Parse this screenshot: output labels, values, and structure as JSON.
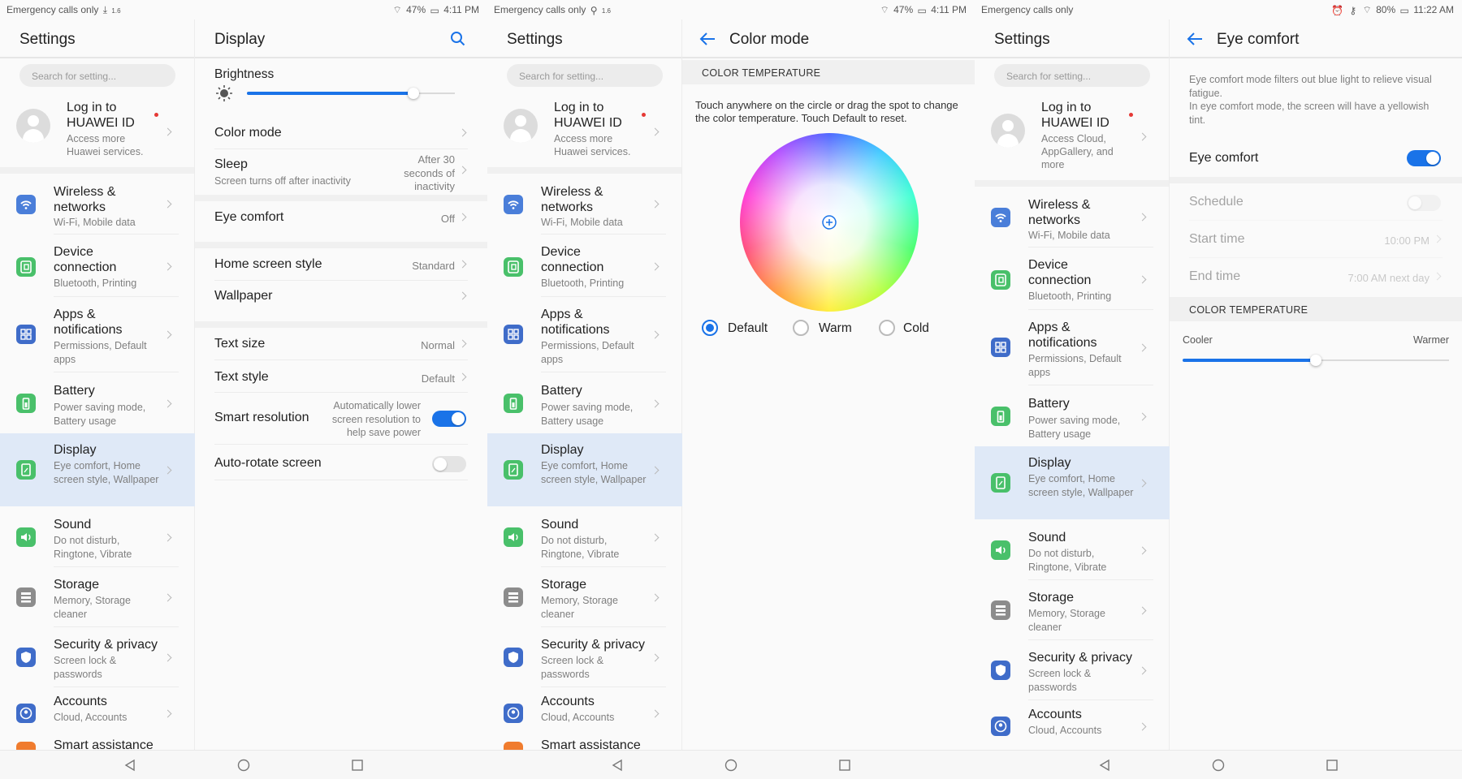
{
  "settings_list": {
    "title": "Settings",
    "search_placeholder": "Search for setting...",
    "account": {
      "name": "Log in to HUAWEI ID",
      "sub_a": "Access more Huawei services.",
      "sub_c": "Access Cloud, AppGallery, and more"
    },
    "items": [
      {
        "title": "Wireless & networks",
        "sub": "Wi-Fi, Mobile data",
        "icon": "wifi-icon"
      },
      {
        "title": "Device connection",
        "sub": "Bluetooth, Printing",
        "icon": "device-connection-icon"
      },
      {
        "title": "Apps & notifications",
        "sub": "Permissions, Default apps",
        "icon": "apps-icon"
      },
      {
        "title": "Battery",
        "sub": "Power saving mode, Battery usage",
        "icon": "battery-icon"
      },
      {
        "title": "Display",
        "sub": "Eye comfort, Home screen style, Wallpaper",
        "icon": "display-icon"
      },
      {
        "title": "Sound",
        "sub": "Do not disturb, Ringtone, Vibrate",
        "icon": "sound-icon"
      },
      {
        "title": "Storage",
        "sub": "Memory, Storage cleaner",
        "icon": "storage-icon"
      },
      {
        "title": "Security & privacy",
        "sub": "Screen lock & passwords",
        "icon": "shield-icon"
      },
      {
        "title": "Accounts",
        "sub": "Cloud, Accounts",
        "icon": "accounts-icon"
      },
      {
        "title": "Smart assistance",
        "sub": "",
        "icon": "smart-assistance-icon"
      }
    ]
  },
  "status": {
    "left": "Emergency calls only",
    "speed": "1.6",
    "speed_unit": "K/s",
    "battery_a": "47%",
    "time_a": "4:11 PM",
    "battery_c": "80%",
    "time_c": "11:22 AM"
  },
  "display": {
    "title": "Display",
    "brightness_label": "Brightness",
    "brightness_level": 0.8,
    "rows": {
      "color_mode": "Color mode",
      "sleep": "Sleep",
      "sleep_sub": "Screen turns off after inactivity",
      "sleep_value": "After 30 seconds of inactivity",
      "eye_comfort": "Eye comfort",
      "eye_comfort_value": "Off",
      "home_style": "Home screen style",
      "home_style_value": "Standard",
      "wallpaper": "Wallpaper",
      "text_size": "Text size",
      "text_size_value": "Normal",
      "text_style": "Text style",
      "text_style_value": "Default",
      "smart_res": "Smart resolution",
      "smart_res_desc": "Automatically lower screen resolution to help save power",
      "auto_rotate": "Auto-rotate screen"
    }
  },
  "color_mode": {
    "title": "Color mode",
    "section": "COLOR TEMPERATURE",
    "instruction": "Touch anywhere on the circle or drag the spot to change the color temperature. Touch Default to reset.",
    "options": [
      "Default",
      "Warm",
      "Cold"
    ],
    "selected": "Default"
  },
  "eye_comfort": {
    "title": "Eye comfort",
    "desc1": "Eye comfort mode filters out blue light to relieve visual fatigue.",
    "desc2": "In eye comfort mode, the screen will have a yellowish tint.",
    "toggle_label": "Eye comfort",
    "schedule": "Schedule",
    "start_time": "Start time",
    "start_value": "10:00 PM",
    "end_time": "End time",
    "end_value": "7:00 AM next day",
    "section": "COLOR TEMPERATURE",
    "cooler": "Cooler",
    "warmer": "Warmer",
    "temperature_level": 0.5
  },
  "nav_icons": [
    "back-triangle-icon",
    "home-circle-icon",
    "recents-square-icon"
  ]
}
